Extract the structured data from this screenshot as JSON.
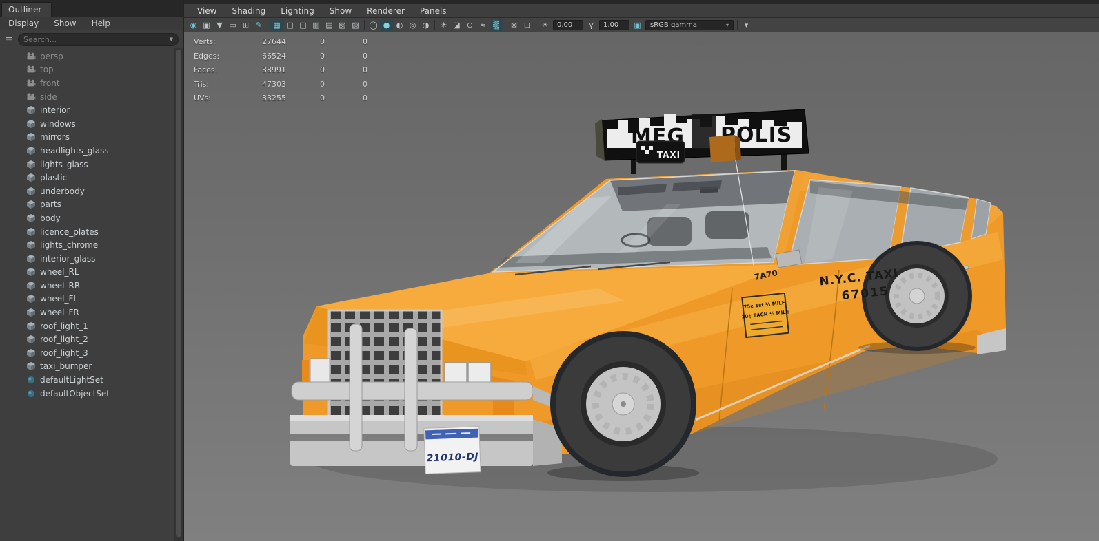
{
  "outliner": {
    "tab_title": "Outliner",
    "menus": [
      "Display",
      "Show",
      "Help"
    ],
    "search_placeholder": "Search...",
    "cameras": [
      "persp",
      "top",
      "front",
      "side"
    ],
    "meshes": [
      "interior",
      "windows",
      "mirrors",
      "headlights_glass",
      "lights_glass",
      "plastic",
      "underbody",
      "parts",
      "body",
      "licence_plates",
      "lights_chrome",
      "interior_glass",
      "wheel_RL",
      "wheel_RR",
      "wheel_FL",
      "wheel_FR",
      "roof_light_1",
      "roof_light_2",
      "roof_light_3",
      "taxi_bumper"
    ],
    "sets": [
      "defaultLightSet",
      "defaultObjectSet"
    ]
  },
  "viewport": {
    "menus": [
      "View",
      "Shading",
      "Lighting",
      "Show",
      "Renderer",
      "Panels"
    ],
    "toolbar": {
      "exposure": "0.00",
      "gamma": "1.00",
      "color_transform": "sRGB gamma"
    },
    "hud": {
      "rows": [
        {
          "label": "Verts:",
          "total": "27644",
          "selected": "0",
          "other": "0"
        },
        {
          "label": "Edges:",
          "total": "66524",
          "selected": "0",
          "other": "0"
        },
        {
          "label": "Faces:",
          "total": "38991",
          "selected": "0",
          "other": "0"
        },
        {
          "label": "Tris:",
          "total": "47303",
          "selected": "0",
          "other": "0"
        },
        {
          "label": "UVs:",
          "total": "33255",
          "selected": "0",
          "other": "0"
        }
      ]
    }
  },
  "scene": {
    "roof_sign_left": "MEG",
    "roof_sign_right": "POLIS",
    "roof_taxi_sign": "TAXI",
    "door_line1": "N.Y.C. TAXI",
    "door_line2": "67015",
    "hood_number": "7A70",
    "fare_line1": "75¢ 1st ⅓ MILE",
    "fare_line2": "10¢ EACH ⅓ MILE",
    "plate_number": "21010-DJ"
  },
  "icons": {
    "list": "≡",
    "search_filter": "▼",
    "camera": "◉",
    "lock_camera": "▣",
    "bookmarks": "▼",
    "image_plane": "▭",
    "pan_zoom": "⊞",
    "grease_pencil": "✎",
    "grid": "▦",
    "film_gate": "□",
    "resolution_gate": "◫",
    "gate_mask": "▥",
    "field_chart": "▤",
    "safe_action": "▧",
    "safe_title": "▨",
    "wireframe": "◯",
    "smooth_shade": "●",
    "textured": "◐",
    "wire_on_shaded": "◎",
    "default_material": "◑",
    "lights": "☀",
    "shadows": "◪",
    "ao": "⊙",
    "motion_blur": "≈",
    "multisample": "▒",
    "xray": "⊠",
    "isolate": "⊡",
    "exposure": "☀",
    "gamma": "γ",
    "color_mgmt": "▣",
    "dropdown_arrow": "▾"
  },
  "colors": {
    "taxi_orange": "#ef9a28",
    "accent_teal": "#5fb5c4"
  }
}
